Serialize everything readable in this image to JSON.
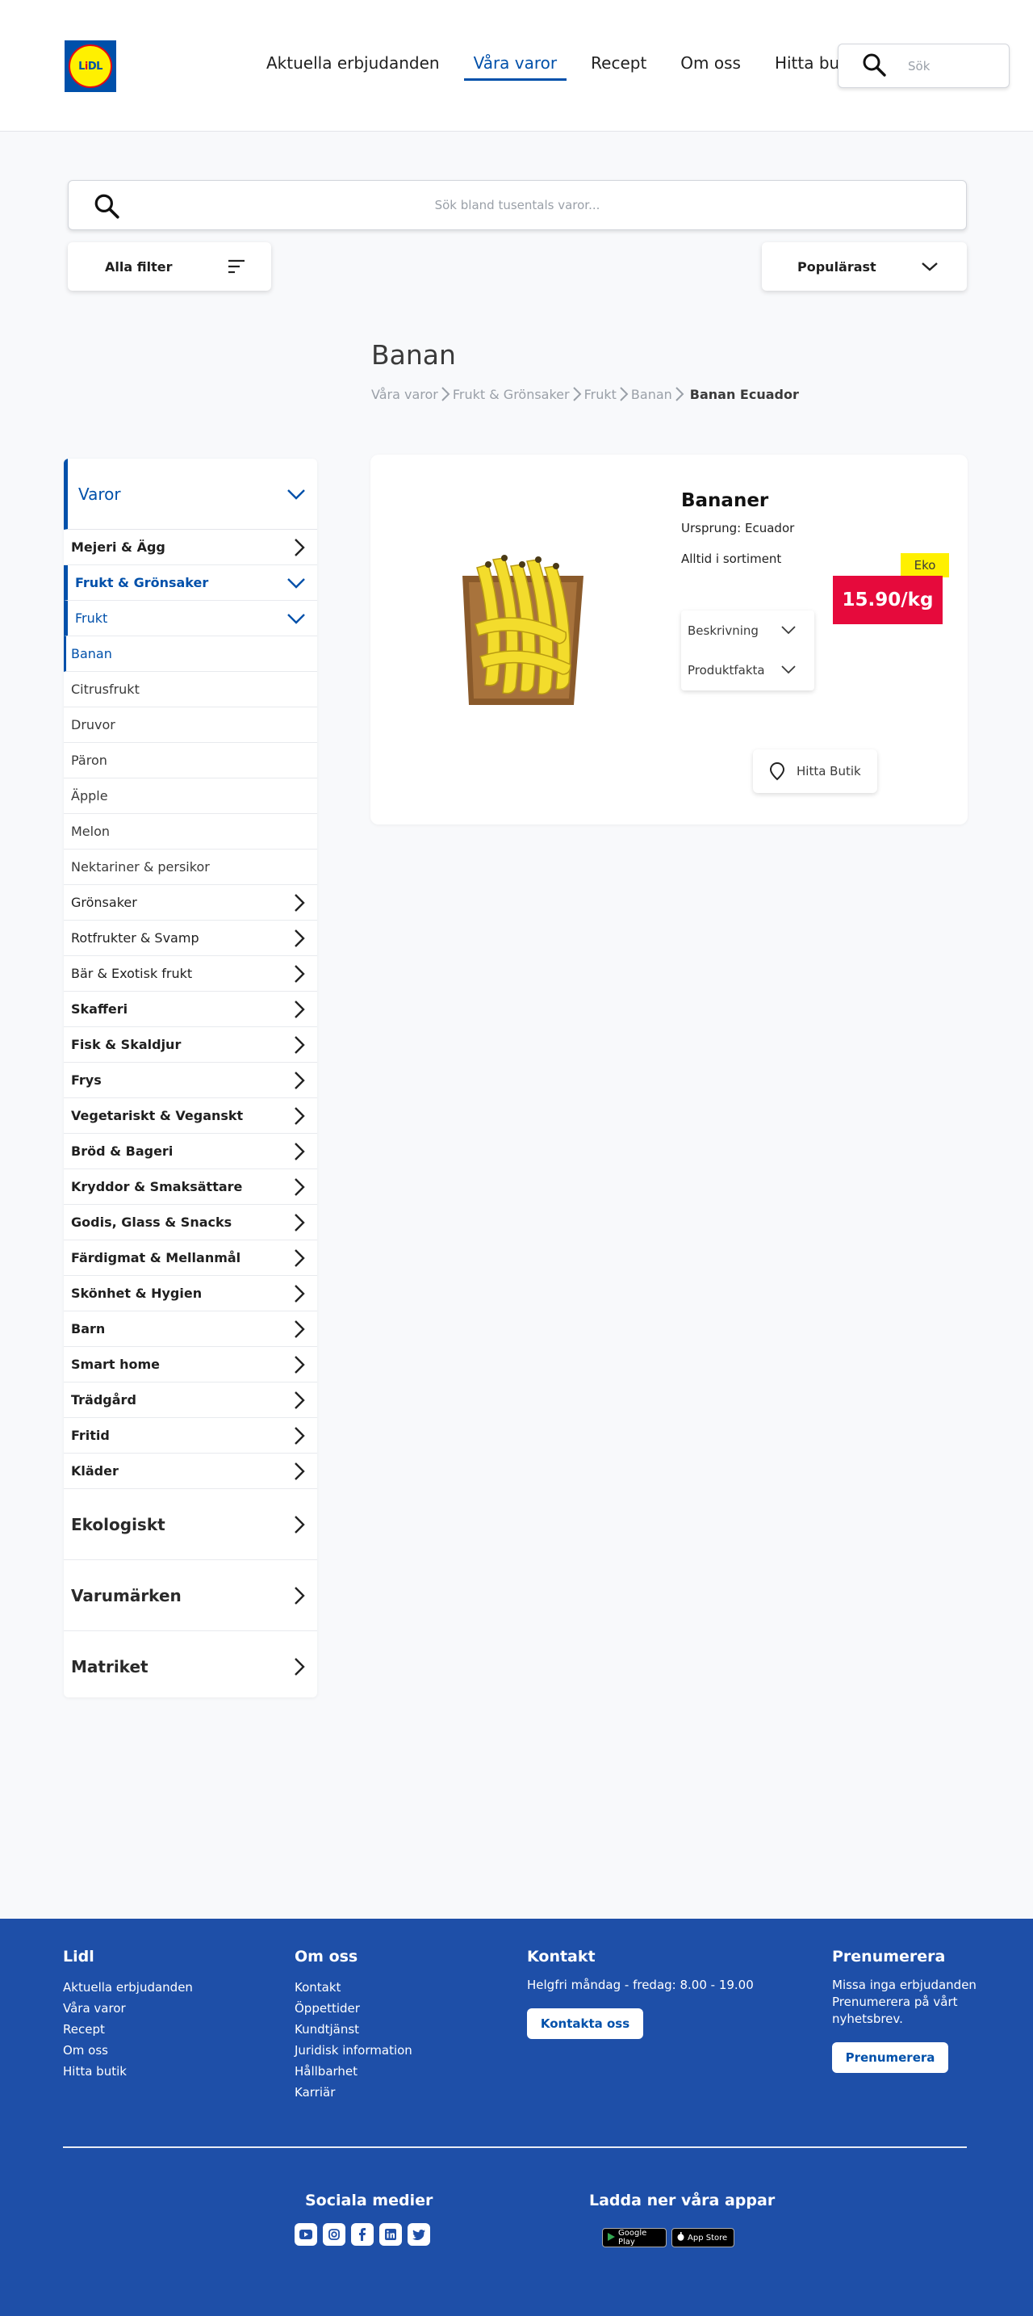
{
  "brand": {
    "logo_text": "LIDL",
    "colors": {
      "blue": "#0050aa",
      "yellow": "#fff000",
      "red": "#e60a14",
      "price_red": "#e60a3c",
      "footer_blue": "#1e4fa8"
    }
  },
  "header": {
    "nav": [
      {
        "label": "Aktuella erbjudanden"
      },
      {
        "label": "Våra varor"
      },
      {
        "label": "Recept"
      },
      {
        "label": "Om oss"
      },
      {
        "label": "Hitta butik"
      }
    ],
    "active_nav": "Våra varor",
    "search_placeholder": "Sök"
  },
  "search": {
    "placeholder": "Sök bland tusentals varor..."
  },
  "filter": {
    "label": "Alla filter"
  },
  "sort": {
    "label": "Populärast"
  },
  "page": {
    "title": "Banan",
    "breadcrumb": [
      "Våra varor",
      "Frukt & Grönsaker",
      "Frukt",
      "Banan"
    ],
    "breadcrumb_current": "Banan Ecuador"
  },
  "sidebar": {
    "heading": "Varor",
    "items": [
      {
        "label": "Mejeri & Ägg"
      },
      {
        "label": "Frukt & Grönsaker"
      },
      {
        "label": "Frukt"
      },
      {
        "label": "Banan"
      },
      {
        "label": "Citrusfrukt"
      },
      {
        "label": "Druvor"
      },
      {
        "label": "Päron"
      },
      {
        "label": "Äpple"
      },
      {
        "label": "Melon"
      },
      {
        "label": "Nektariner & persikor"
      },
      {
        "label": "Grönsaker"
      },
      {
        "label": "Rotfrukter & Svamp"
      },
      {
        "label": "Bär & Exotisk frukt"
      },
      {
        "label": "Skafferi"
      },
      {
        "label": "Fisk & Skaldjur"
      },
      {
        "label": "Frys"
      },
      {
        "label": "Vegetariskt & Veganskt"
      },
      {
        "label": "Bröd & Bageri"
      },
      {
        "label": "Kryddor & Smaksättare"
      },
      {
        "label": "Godis, Glass & Snacks"
      },
      {
        "label": "Färdigmat & Mellanmål"
      },
      {
        "label": "Skönhet & Hygien"
      },
      {
        "label": "Barn"
      },
      {
        "label": "Smart home"
      },
      {
        "label": "Trädgård"
      },
      {
        "label": "Fritid"
      },
      {
        "label": "Kläder"
      }
    ],
    "sections": [
      {
        "label": "Ekologiskt"
      },
      {
        "label": "Varumärken"
      },
      {
        "label": "Matriket"
      }
    ]
  },
  "product": {
    "name": "Bananer",
    "origin": "Ursprung: Ecuador",
    "availability": "Alltid i sortiment",
    "badge": "Eko",
    "price": "15.90/kg",
    "accordion": [
      {
        "label": "Beskrivning"
      },
      {
        "label": "Produktfakta"
      }
    ],
    "find_store": "Hitta Butik"
  },
  "footer": {
    "lidl": {
      "title": "Lidl",
      "links": [
        "Aktuella erbjudanden",
        "Våra varor",
        "Recept",
        "Om oss",
        "Hitta butik"
      ]
    },
    "about": {
      "title": "Om oss",
      "links": [
        "Kontakt",
        "Öppettider",
        "Kundtjänst",
        "Juridisk information",
        "Hållbarhet",
        "Karriär"
      ]
    },
    "contact": {
      "title": "Kontakt",
      "hours": "Helgfri måndag - fredag: 8.00 - 19.00",
      "button": "Kontakta oss"
    },
    "newsletter": {
      "title": "Prenumerera",
      "text": "Missa inga erbjudanden Prenumerera på vårt nyhetsbrev.",
      "button": "Prenumerera"
    },
    "social": {
      "title": "Sociala medier",
      "icons": [
        "youtube-icon",
        "instagram-icon",
        "facebook-icon",
        "linkedin-icon",
        "twitter-icon"
      ]
    },
    "apps": {
      "title": "Ladda ner våra appar",
      "google_play": "Google Play",
      "app_store": "App Store"
    }
  }
}
